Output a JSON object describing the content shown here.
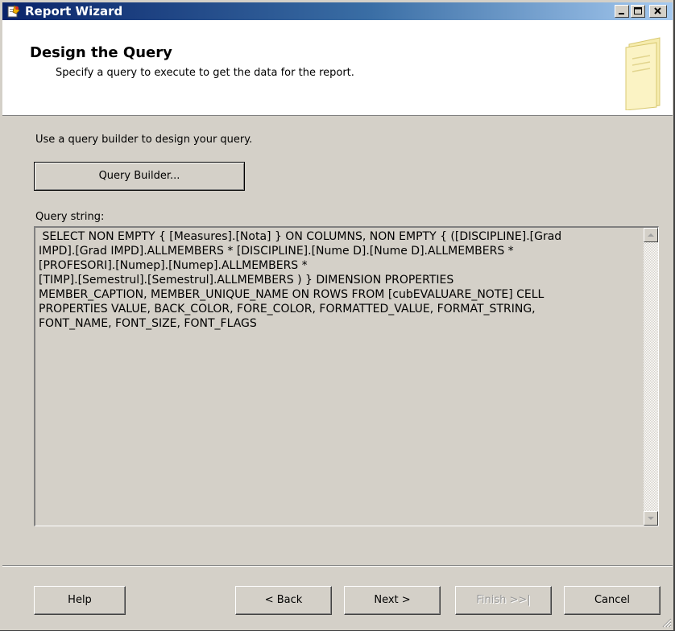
{
  "window": {
    "title": "Report Wizard",
    "icon": "report-wizard-icon"
  },
  "header": {
    "title": "Design the Query",
    "subtitle": "Specify a query to execute to get the data for the report."
  },
  "main": {
    "hint": "Use a query builder to design your query.",
    "query_builder_label": "Query Builder...",
    "query_string_label": "Query string:",
    "query_string": " SELECT NON EMPTY { [Measures].[Nota] } ON COLUMNS, NON EMPTY { ([DISCIPLINE].[Grad\nIMPD].[Grad IMPD].ALLMEMBERS * [DISCIPLINE].[Nume D].[Nume D].ALLMEMBERS *\n[PROFESORI].[Numep].[Numep].ALLMEMBERS *\n[TIMP].[Semestrul].[Semestrul].ALLMEMBERS ) } DIMENSION PROPERTIES\nMEMBER_CAPTION, MEMBER_UNIQUE_NAME ON ROWS FROM [cubEVALUARE_NOTE] CELL\nPROPERTIES VALUE, BACK_COLOR, FORE_COLOR, FORMATTED_VALUE, FORMAT_STRING,\nFONT_NAME, FONT_SIZE, FONT_FLAGS"
  },
  "footer": {
    "help_label": "Help",
    "back_label": "< Back",
    "next_label": "Next >",
    "finish_label": "Finish >>|",
    "cancel_label": "Cancel"
  },
  "colors": {
    "titlebar_start": "#0a246a",
    "titlebar_end": "#a6caf0",
    "face": "#d4d0c8"
  }
}
